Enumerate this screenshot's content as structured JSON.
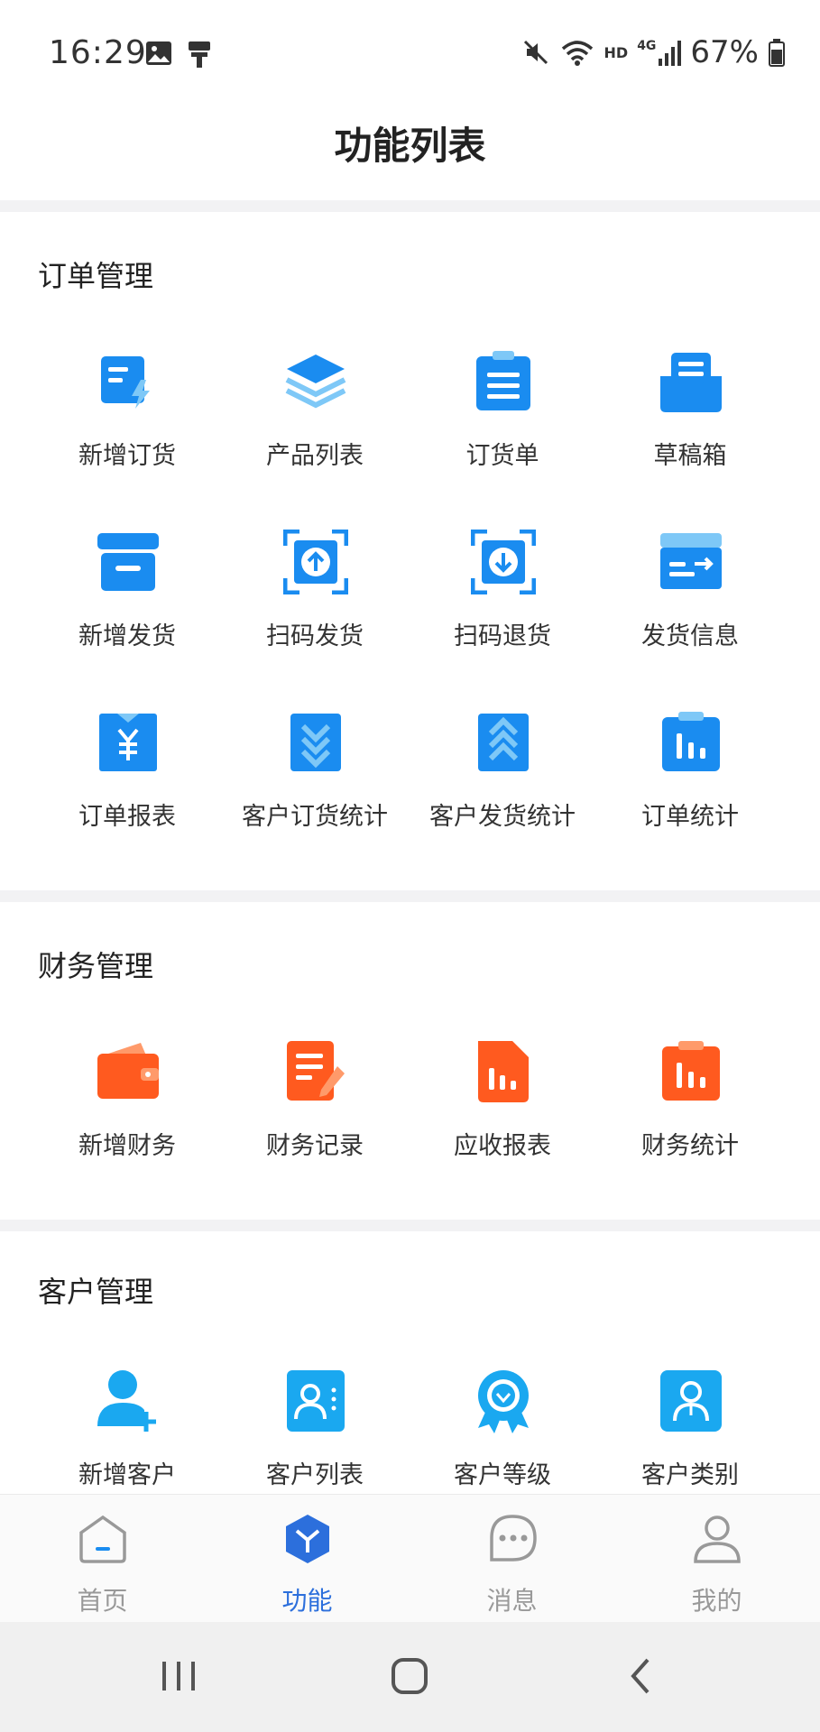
{
  "status": {
    "time": "16:29",
    "battery": "67%",
    "net_label": "HD",
    "sig_label": "4G"
  },
  "header": {
    "title": "功能列表"
  },
  "sections": [
    {
      "title": "订单管理",
      "items": [
        {
          "label": "新增订货",
          "icon": "new-order-icon"
        },
        {
          "label": "产品列表",
          "icon": "layers-icon"
        },
        {
          "label": "订货单",
          "icon": "clipboard-icon"
        },
        {
          "label": "草稿箱",
          "icon": "inbox-icon"
        },
        {
          "label": "新增发货",
          "icon": "box-icon"
        },
        {
          "label": "扫码发货",
          "icon": "scan-up-icon"
        },
        {
          "label": "扫码退货",
          "icon": "scan-down-icon"
        },
        {
          "label": "发货信息",
          "icon": "card-arrow-icon"
        },
        {
          "label": "订单报表",
          "icon": "yen-report-icon"
        },
        {
          "label": "客户订货统计",
          "icon": "chevrons-down-icon"
        },
        {
          "label": "客户发货统计",
          "icon": "chevrons-up-icon"
        },
        {
          "label": "订单统计",
          "icon": "bar-stats-icon"
        }
      ]
    },
    {
      "title": "财务管理",
      "items": [
        {
          "label": "新增财务",
          "icon": "wallet-icon"
        },
        {
          "label": "财务记录",
          "icon": "document-pen-icon"
        },
        {
          "label": "应收报表",
          "icon": "file-chart-icon"
        },
        {
          "label": "财务统计",
          "icon": "clipboard-chart-icon"
        }
      ]
    },
    {
      "title": "客户管理",
      "items": [
        {
          "label": "新增客户",
          "icon": "add-user-icon"
        },
        {
          "label": "客户列表",
          "icon": "contact-card-icon"
        },
        {
          "label": "客户等级",
          "icon": "award-badge-icon"
        },
        {
          "label": "客户类别",
          "icon": "user-badge-icon"
        }
      ]
    }
  ],
  "tabs": [
    {
      "label": "首页",
      "icon": "home-icon",
      "active": false
    },
    {
      "label": "功能",
      "icon": "cube-icon",
      "active": true
    },
    {
      "label": "消息",
      "icon": "message-icon",
      "active": false
    },
    {
      "label": "我的",
      "icon": "profile-icon",
      "active": false
    }
  ],
  "colors": {
    "blue": "#1a8cf0",
    "light_blue": "#7ec8f7",
    "orange": "#ff5a1f",
    "light_orange": "#ff9a6a",
    "tab_active": "#2c6fdc"
  }
}
